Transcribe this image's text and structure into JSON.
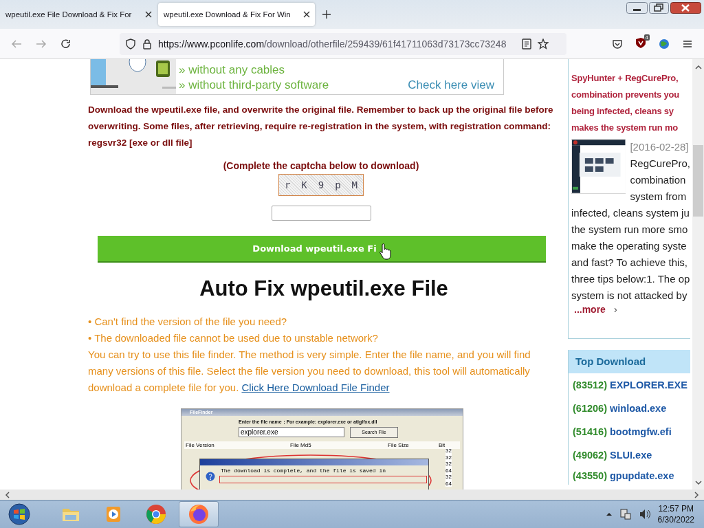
{
  "browser": {
    "tabs": [
      {
        "title": "wpeutil.exe File Download & Fix For",
        "selected": false
      },
      {
        "title": "wpeutil.exe Download & Fix For Win",
        "selected": true
      }
    ],
    "url_host": "https://www.pconlife.com",
    "url_path": "/download/otherfile/259439/61f41711063d73173cc73248",
    "extension_badge": "4"
  },
  "banner": {
    "lines": [
      "» without any cables",
      "» without third-party software"
    ],
    "link": "Check here view"
  },
  "notice": "Download the wpeutil.exe file, and overwrite the original file. Remember to back up the original file before overwriting. Some files, after retrieving, require re-registration in the system, with registration command: regsvr32 [exe or dll file]",
  "captcha": {
    "prompt": "(Complete the captcha below to download)",
    "characters": [
      "r",
      "K",
      "9",
      "p",
      "M"
    ]
  },
  "download_button": "Download wpeutil.exe Fi",
  "autofix": {
    "heading": "Auto Fix wpeutil.exe File",
    "bullets": [
      "• Can't find the version of the file you need?",
      "• The downloaded file cannot be used due to unstable network?"
    ],
    "text": "You can try to use this file finder. The method is very simple. Enter the file name, and you will find many versions of this file. Select the file version you need to download, this tool will automatically download a complete file for you.",
    "link": "Click Here Download File Finder"
  },
  "file_finder": {
    "title": "FileFinder",
    "prompt": "Enter the file name：For example: explorer.exe or atiglfxx.dll",
    "value": "explorer.exe",
    "button": "Search File",
    "columns": [
      "File Version",
      "File Md5",
      "File Size",
      "Bit"
    ],
    "bits": [
      "32",
      "32",
      "32",
      "64",
      "32",
      "64"
    ],
    "dialog_text": "The download is complete, and the file is saved in"
  },
  "sidebar": {
    "title_lines": [
      "SpyHunter + RegCurePro,",
      "combination prevents you",
      "being infected, cleans sy",
      "makes the system run mo"
    ],
    "date": "[2016-02-28]",
    "body_lines_beside": [
      "RegCurePro,",
      "combination",
      "system from"
    ],
    "body_lines": [
      "infected, cleans system ju",
      "the system run more smo",
      "make the operating syste",
      "and fast? To achieve this,",
      "three tips below:1. The op",
      "system is not attacked by"
    ],
    "more": "...more",
    "more_arrow": "›",
    "top_download": {
      "title": "Top Download",
      "items": [
        {
          "count": "(83512)",
          "name": "EXPLORER.EXE"
        },
        {
          "count": "(61206)",
          "name": "winload.exe"
        },
        {
          "count": "(51416)",
          "name": "bootmgfw.efi"
        },
        {
          "count": "(49062)",
          "name": "SLUI.exe"
        },
        {
          "count": "(43550)",
          "name": "gpupdate.exe"
        }
      ]
    }
  },
  "taskbar": {
    "apps": [
      {
        "kind": "folder",
        "selected": false
      },
      {
        "kind": "media",
        "selected": false
      },
      {
        "kind": "chrome",
        "selected": false
      },
      {
        "kind": "firefox",
        "selected": true
      }
    ],
    "time": "12:57 PM",
    "date": "6/30/2022"
  }
}
